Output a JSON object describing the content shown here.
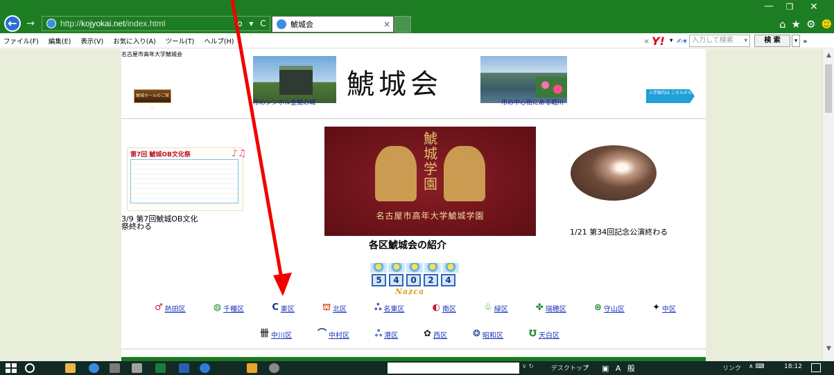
{
  "browser": {
    "url_prefix": "http://",
    "url_host": "kojyokai.net",
    "url_path": "/index.html",
    "addr_tools": "ρ ▾ C",
    "tab_title": "鯱城会",
    "tab_close": "×",
    "back_icon": "back-arrow-icon",
    "back_glyph": "←",
    "forward_glyph": "→",
    "win_min": "—",
    "win_max": "❐",
    "win_close": "✕",
    "right_icons": [
      "⌂",
      "★",
      "⚙",
      "☻"
    ]
  },
  "menubar": {
    "items": [
      "ファイル(F)",
      "編集(E)",
      "表示(V)",
      "お気に入り(A)",
      "ツール(T)",
      "ヘルプ(H)"
    ],
    "search_placeholder": "入力して検索",
    "search_button": "検 索",
    "yahoo": "Y!",
    "close_glyph": "×",
    "dd_glyph": "▾",
    "pen_glyph": "✍▾",
    "chev_glyph": "»"
  },
  "site": {
    "org_name": "名古屋市高年大学鯱城会",
    "title": "鯱城会",
    "left_banner": "鯱城ホールのご案内",
    "castle_caption": "市のシンボル金鯱の城",
    "river_caption": "市の中心街にある堀川",
    "enroll_button": "入学案内は こちらから",
    "flyer_header": "第7回 鯱城OB文化祭",
    "flyer_notes": "♪♫",
    "left_caption": "3/9 第7回鯱城OB文化祭終わる",
    "emblem_kanji": "鯱城学園",
    "emblem_name": "名古屋市高年大学鯱城学園",
    "right_caption": "1/21 第34回記念公演終わる",
    "intro_heading": "各区鯱城会の紹介",
    "counter_digits": [
      "5",
      "4",
      "0",
      "2",
      "4"
    ],
    "counter_label": "Nazca"
  },
  "wards_row1": [
    {
      "label": "熱田区",
      "icon": "atsuta-ward-emblem-icon",
      "glyph": "♂",
      "color": "#d0152a"
    },
    {
      "label": "千種区",
      "icon": "chikusa-ward-emblem-icon",
      "glyph": "◍",
      "color": "#1d8a2a"
    },
    {
      "label": "東区",
      "icon": "higashi-ward-emblem-icon",
      "glyph": "C",
      "color": "#1a2e7a"
    },
    {
      "label": "北区",
      "icon": "kita-ward-emblem-icon",
      "glyph": "⛫",
      "color": "#d23a0a"
    },
    {
      "label": "名東区",
      "icon": "meito-ward-emblem-icon",
      "glyph": "ஃ",
      "color": "#1a2e9a"
    },
    {
      "label": "南区",
      "icon": "minami-ward-emblem-icon",
      "glyph": "◐",
      "color": "#d0152a"
    },
    {
      "label": "緑区",
      "icon": "midori-ward-emblem-icon",
      "glyph": "♧",
      "color": "#1d8a2a"
    },
    {
      "label": "瑞穂区",
      "icon": "mizuho-ward-emblem-icon",
      "glyph": "✤",
      "color": "#1d8a2a"
    },
    {
      "label": "守山区",
      "icon": "moriyama-ward-emblem-icon",
      "glyph": "⊛",
      "color": "#1d8a2a"
    },
    {
      "label": "中区",
      "icon": "naka-ward-emblem-icon",
      "glyph": "✦",
      "color": "#111111"
    }
  ],
  "wards_row2": [
    {
      "label": "中川区",
      "icon": "nakagawa-ward-emblem-icon",
      "glyph": "卌",
      "color": "#333333"
    },
    {
      "label": "中村区",
      "icon": "nakamura-ward-emblem-icon",
      "glyph": "⌒",
      "color": "#1a2e7a"
    },
    {
      "label": "港区",
      "icon": "minato-ward-emblem-icon",
      "glyph": "ஃ",
      "color": "#1a50b0"
    },
    {
      "label": "西区",
      "icon": "nishi-ward-emblem-icon",
      "glyph": "✿",
      "color": "#222222"
    },
    {
      "label": "昭和区",
      "icon": "showa-ward-emblem-icon",
      "glyph": "❂",
      "color": "#1a2e7a"
    },
    {
      "label": "天白区",
      "icon": "tempaku-ward-emblem-icon",
      "glyph": "℧",
      "color": "#1d8a2a"
    }
  ],
  "taskbar": {
    "dd": "∨ ↻",
    "desktop_label": "デスクトップ",
    "desktop_sep": "»",
    "ime": "▣ A 般",
    "links": "リンク",
    "tray": "∧ ⌨",
    "clock": "18:12"
  },
  "colors": {
    "chrome_green": "#1d7d22",
    "page_bg": "#e9eedb",
    "link_blue": "#1a34b8",
    "annotation_red": "#f20000"
  }
}
